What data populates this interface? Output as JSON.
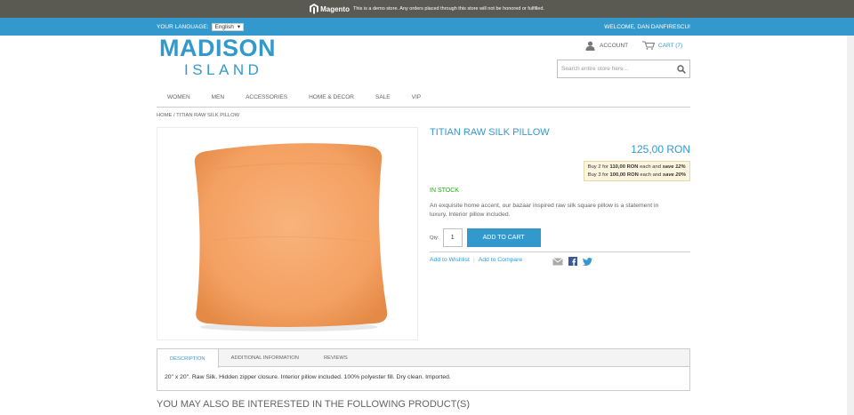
{
  "demo_notice": {
    "brand": "Magento",
    "text": "This is a demo store. Any orders placed through this store will not be honored or fulfilled."
  },
  "top_bar": {
    "language_label": "YOUR LANGUAGE:",
    "language_value": "English",
    "welcome": "WELCOME, DAN DANFIRESCU!"
  },
  "header": {
    "logo_line1": "MADISON",
    "logo_line2": "ISLAND",
    "account_label": "ACCOUNT",
    "cart_label": "CART (7)",
    "search_placeholder": "Search entire store here..."
  },
  "nav": {
    "items": [
      "WOMEN",
      "MEN",
      "ACCESSORIES",
      "HOME & DECOR",
      "SALE",
      "VIP"
    ]
  },
  "breadcrumb": {
    "home": "HOME",
    "separator": "/",
    "current": "TITIAN RAW SILK PILLOW"
  },
  "product": {
    "title": "TITIAN RAW SILK PILLOW",
    "price": "125,00 RON",
    "tier1_pre": "Buy 2 for",
    "tier1_price": "110,00 RON",
    "tier1_mid": "each and",
    "tier1_save": "save 12%",
    "tier2_pre": "Buy 3 for",
    "tier2_price": "100,00 RON",
    "tier2_mid": "each and",
    "tier2_save": "save 20%",
    "stock": "IN STOCK",
    "short_description": "An exquisite home accent, our bazaar inspired raw silk square pillow is a statement in luxury. Interior pillow included.",
    "qty_label": "Qty:",
    "qty_value": "1",
    "add_to_cart": "ADD TO CART",
    "wishlist": "Add to Wishlist",
    "compare": "Add to Compare",
    "pillow_color": "#f4a062"
  },
  "tabs": {
    "items": [
      "DESCRIPTION",
      "ADDITIONAL INFORMATION",
      "REVIEWS"
    ],
    "body": "20\" x 20\". Raw Silk. Hidden zipper closure. Interior pillow included. 100% polyester fill. Dry clean. Imported."
  },
  "related_heading": "YOU MAY ALSO BE INTERESTED IN THE FOLLOWING PRODUCT(S)",
  "colors": {
    "accent": "#3399cc",
    "demo_bar": "#5a5a52",
    "stock_green": "#11b400"
  }
}
